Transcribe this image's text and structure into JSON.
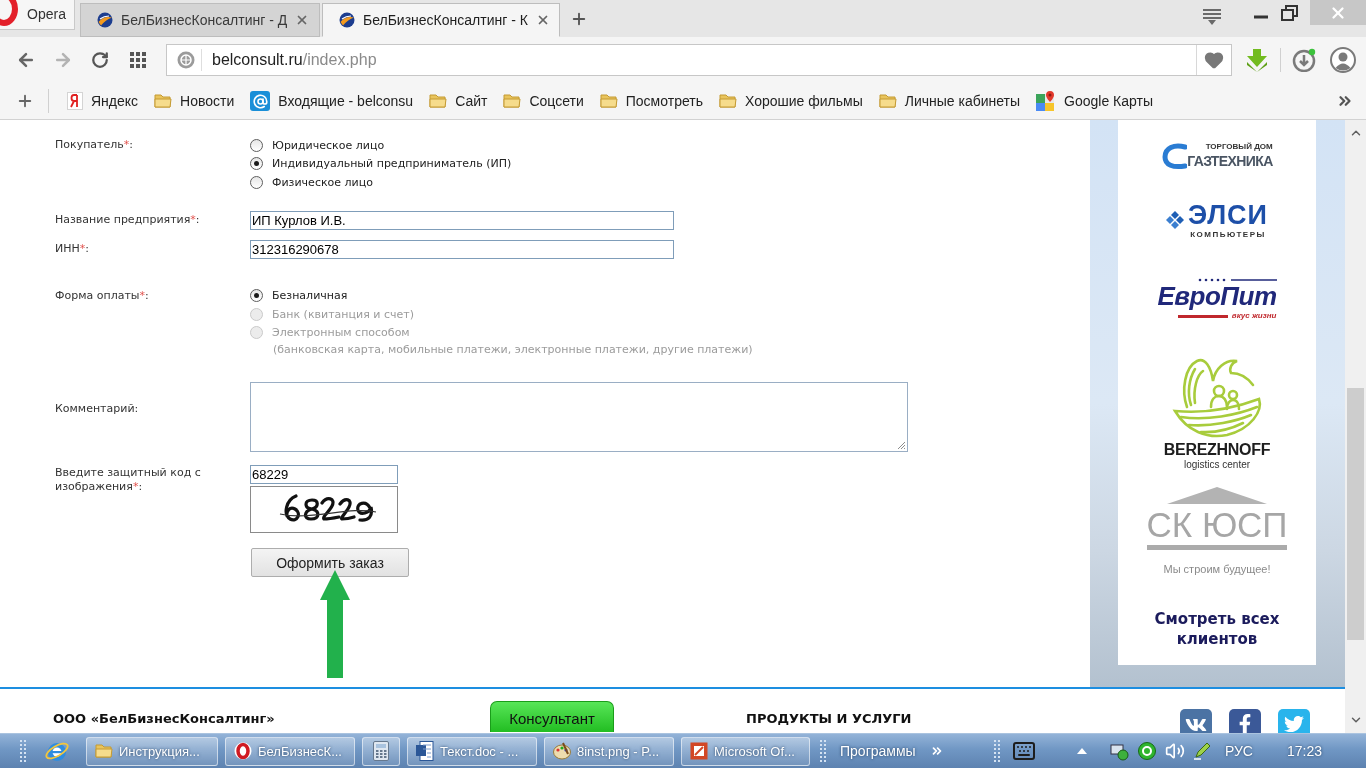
{
  "browser": {
    "menu_button": "Opera",
    "tabs": [
      {
        "title": "БелБизнесКонсалтинг - Д",
        "selected": false
      },
      {
        "title": "БелБизнесКонсалтинг - К",
        "selected": true
      }
    ],
    "address": {
      "host": "belconsult.ru",
      "path": "/index.php"
    },
    "bookmarks": [
      {
        "kind": "yandex",
        "label": "Яндекс"
      },
      {
        "kind": "folder",
        "label": "Новости"
      },
      {
        "kind": "mail",
        "label": "Входящие - belconsu"
      },
      {
        "kind": "folder",
        "label": "Сайт"
      },
      {
        "kind": "folder",
        "label": "Соцсети"
      },
      {
        "kind": "folder",
        "label": "Посмотреть"
      },
      {
        "kind": "folder",
        "label": "Хорошие фильмы"
      },
      {
        "kind": "folder",
        "label": "Личные кабинеты"
      },
      {
        "kind": "maps",
        "label": "Google Карты"
      }
    ]
  },
  "form": {
    "rows": [
      {
        "kind": "radio_group",
        "label": "Покупатель",
        "required_mark": "*",
        "colon": ":",
        "options": [
          {
            "label": "Юридическое лицо",
            "selected": false,
            "disabled": false
          },
          {
            "label": "Индивидуальный предприниматель (ИП)",
            "selected": true,
            "disabled": false
          },
          {
            "label": "Физическое лицо",
            "selected": false,
            "disabled": false
          }
        ]
      },
      {
        "kind": "text",
        "label": "Название предприятия",
        "required_mark": "*",
        "colon": ":",
        "value": "ИП Курлов И.В."
      },
      {
        "kind": "text",
        "label": "ИНН",
        "required_mark": "*",
        "colon": ":",
        "value": "312316290678"
      },
      {
        "kind": "radio_group",
        "label": "Форма оплаты",
        "required_mark": "*",
        "colon": ":",
        "options": [
          {
            "label": "Безналичная",
            "selected": true,
            "disabled": false
          },
          {
            "label": "Банк (квитанция и счет)",
            "selected": false,
            "disabled": true
          },
          {
            "label": "Электронным способом",
            "selected": false,
            "disabled": true,
            "note": "(банковская карта, мобильные платежи, электронные платежи, другие платежи)"
          }
        ]
      },
      {
        "kind": "textarea",
        "label": "Комментарий:"
      },
      {
        "kind": "captcha",
        "label": "Введите защитный код с изображения",
        "required_mark": "*",
        "colon": ":",
        "value": "68229"
      },
      {
        "kind": "submit",
        "text": "Оформить заказ"
      }
    ]
  },
  "sidebar": {
    "clients": [
      {
        "kind": "gaztehnika",
        "name": "ГАЗТЕХНИКА",
        "tagline": "ТОРГОВЫЙ ДОМ"
      },
      {
        "kind": "elsi",
        "name": "ЭЛСИ",
        "tagline": "КОМПЬЮТЕРЫ"
      },
      {
        "kind": "evropit",
        "name": "ЕвроПит",
        "tagline": "вкус жизни"
      },
      {
        "kind": "berezhnoff",
        "name": "BEREZHNOFF",
        "tagline": "logistics center"
      },
      {
        "kind": "skyusp",
        "name": "СК ЮСП",
        "tagline": "Мы строим будущее!"
      }
    ],
    "link": "Смотреть всех клиентов"
  },
  "footer": {
    "company": "ООО «БелБизнесКонсалтинг»",
    "consultant_button": "Консультант",
    "products_heading": "ПРОДУКТЫ И УСЛУГИ",
    "social": [
      {
        "kind": "vk"
      },
      {
        "kind": "facebook"
      },
      {
        "kind": "twitter"
      }
    ]
  },
  "taskbar": {
    "items": [
      {
        "kind": "folder",
        "label": "Инструкция..."
      },
      {
        "kind": "opera",
        "label": "БелБизнесК..."
      },
      {
        "kind": "calculator"
      },
      {
        "kind": "word",
        "label": "Текст.doc - ..."
      },
      {
        "kind": "paint",
        "label": "8inst.png - P..."
      },
      {
        "kind": "office",
        "label": "Microsoft Of..."
      }
    ],
    "toolbar_label": "Программы",
    "language": "РУС",
    "clock": "17:23"
  }
}
